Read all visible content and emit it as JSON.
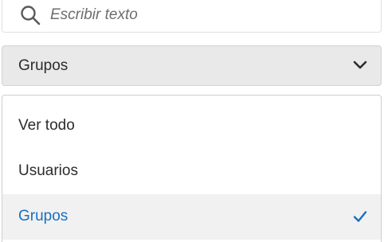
{
  "search": {
    "placeholder": "Escribir texto",
    "icon": "search-icon"
  },
  "select": {
    "value": "Grupos",
    "icon": "chevron-down-icon"
  },
  "menu": {
    "items": [
      {
        "label": "Ver todo",
        "selected": false
      },
      {
        "label": "Usuarios",
        "selected": false
      },
      {
        "label": "Grupos",
        "selected": true
      }
    ],
    "selected_icon": "checkmark-icon"
  },
  "colors": {
    "accent": "#1a6fc0",
    "select_bg": "#e9e9e9",
    "selected_item_bg": "#f1f1f1",
    "text": "#2c2c2c"
  }
}
